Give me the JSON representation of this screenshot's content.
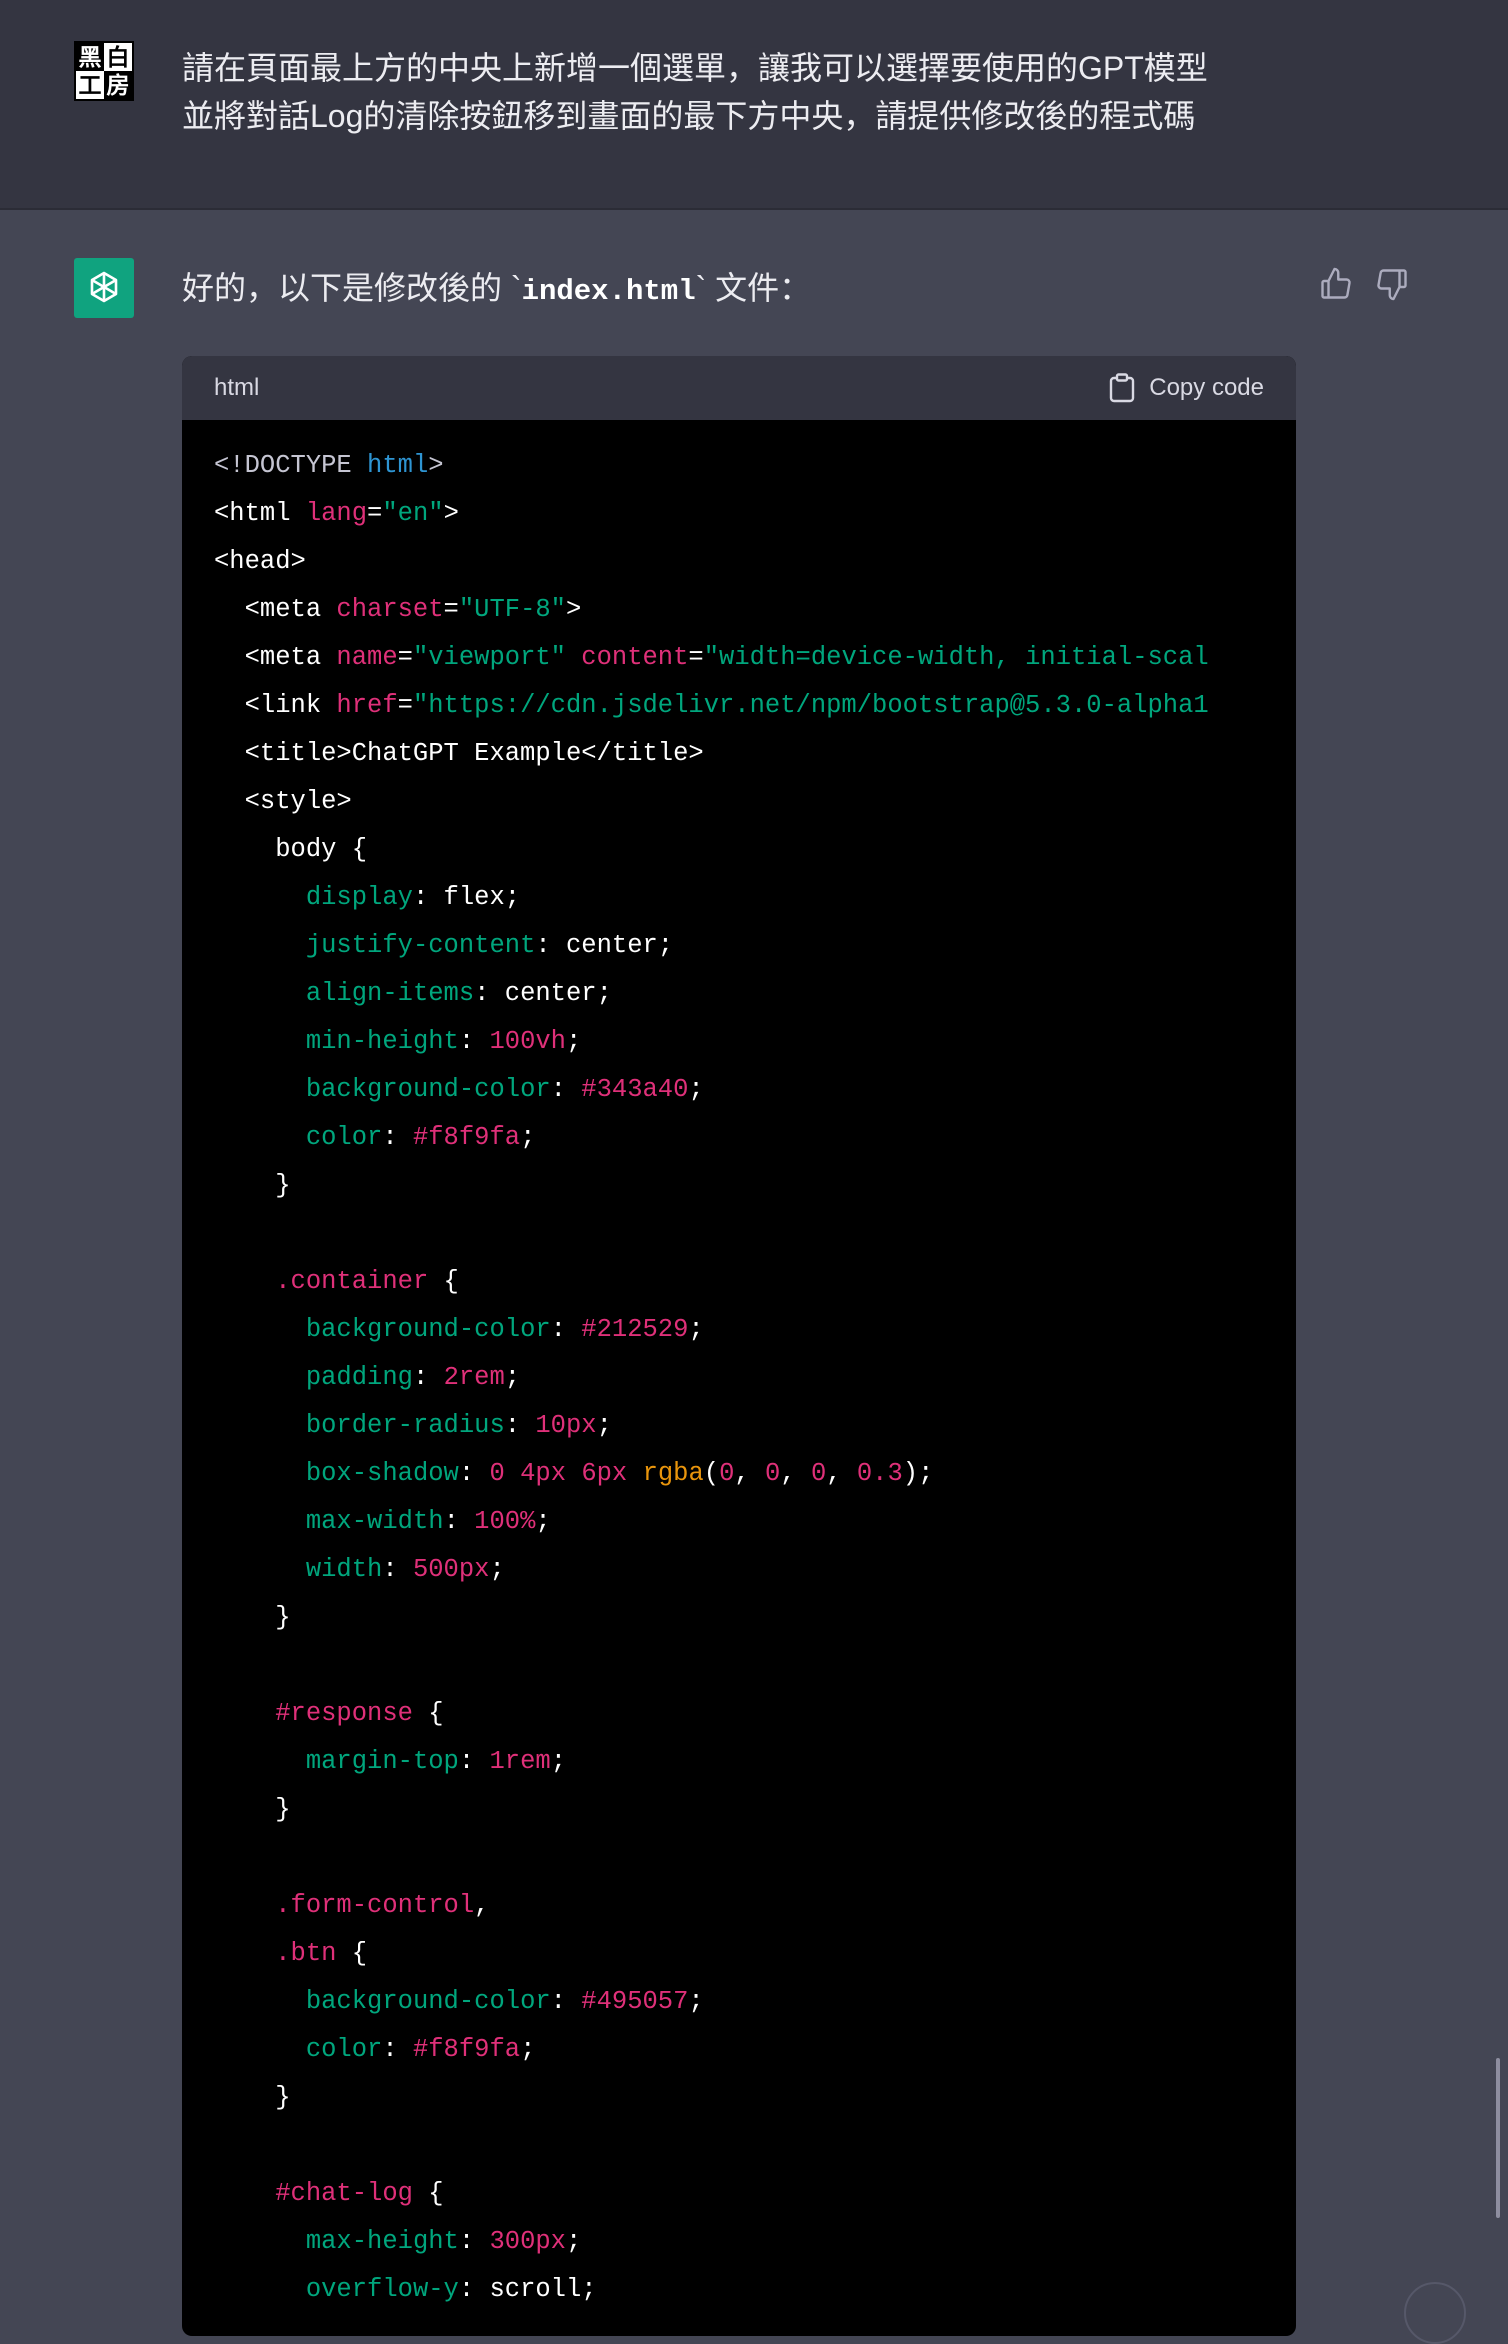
{
  "user": {
    "avatar": {
      "chars": [
        "黑",
        "白",
        "工",
        "房"
      ],
      "icon": "user-avatar-logo"
    },
    "lines": [
      "請在頁面最上方的中央上新增一個選單，讓我可以選擇要使用的GPT模型",
      "並將對話Log的清除按鈕移到畫面的最下方中央，請提供修改後的程式碼"
    ]
  },
  "assistant": {
    "intro_prefix": "好的，以下是修改後的 `",
    "intro_code": "index.html",
    "intro_suffix": "` 文件：",
    "feedback": {
      "thumb_up_icon": "thumbs-up-icon",
      "thumb_down_icon": "thumbs-down-icon"
    }
  },
  "code_block": {
    "language": "html",
    "copy_label": "Copy code",
    "lines": [
      [
        [
          "d",
          "<!DOCTYPE "
        ],
        [
          "k",
          "html"
        ],
        [
          "d",
          ">"
        ]
      ],
      [
        [
          "c",
          "<html "
        ],
        [
          "a",
          "lang"
        ],
        [
          "c",
          "="
        ],
        [
          "s",
          "\"en\""
        ],
        [
          "c",
          ">"
        ]
      ],
      [
        [
          "c",
          "<head>"
        ]
      ],
      [
        [
          "c",
          "  <meta "
        ],
        [
          "a",
          "charset"
        ],
        [
          "c",
          "="
        ],
        [
          "s",
          "\"UTF-8\""
        ],
        [
          "c",
          ">"
        ]
      ],
      [
        [
          "c",
          "  <meta "
        ],
        [
          "a",
          "name"
        ],
        [
          "c",
          "="
        ],
        [
          "s",
          "\"viewport\""
        ],
        [
          "c",
          " "
        ],
        [
          "a",
          "content"
        ],
        [
          "c",
          "="
        ],
        [
          "s",
          "\"width=device-width, initial-scal"
        ]
      ],
      [
        [
          "c",
          "  <link "
        ],
        [
          "a",
          "href"
        ],
        [
          "c",
          "="
        ],
        [
          "s",
          "\"https://cdn.jsdelivr.net/npm/bootstrap@5.3.0-alpha1"
        ]
      ],
      [
        [
          "c",
          "  <title>ChatGPT Example</title>"
        ]
      ],
      [
        [
          "c",
          "  <style>"
        ]
      ],
      [
        [
          "c",
          "    body {"
        ]
      ],
      [
        [
          "c",
          "      "
        ],
        [
          "p",
          "display"
        ],
        [
          "c",
          ": flex;"
        ]
      ],
      [
        [
          "c",
          "      "
        ],
        [
          "p",
          "justify-content"
        ],
        [
          "c",
          ": center;"
        ]
      ],
      [
        [
          "c",
          "      "
        ],
        [
          "p",
          "align-items"
        ],
        [
          "c",
          ": center;"
        ]
      ],
      [
        [
          "c",
          "      "
        ],
        [
          "p",
          "min-height"
        ],
        [
          "c",
          ": "
        ],
        [
          "n",
          "100vh"
        ],
        [
          "c",
          ";"
        ]
      ],
      [
        [
          "c",
          "      "
        ],
        [
          "p",
          "background-color"
        ],
        [
          "c",
          ": "
        ],
        [
          "n",
          "#343a40"
        ],
        [
          "c",
          ";"
        ]
      ],
      [
        [
          "c",
          "      "
        ],
        [
          "p",
          "color"
        ],
        [
          "c",
          ": "
        ],
        [
          "n",
          "#f8f9fa"
        ],
        [
          "c",
          ";"
        ]
      ],
      [
        [
          "c",
          "    }"
        ]
      ],
      [
        [
          "c",
          ""
        ]
      ],
      [
        [
          "c",
          "    "
        ],
        [
          "n",
          ".container"
        ],
        [
          "c",
          " {"
        ]
      ],
      [
        [
          "c",
          "      "
        ],
        [
          "p",
          "background-color"
        ],
        [
          "c",
          ": "
        ],
        [
          "n",
          "#212529"
        ],
        [
          "c",
          ";"
        ]
      ],
      [
        [
          "c",
          "      "
        ],
        [
          "p",
          "padding"
        ],
        [
          "c",
          ": "
        ],
        [
          "n",
          "2rem"
        ],
        [
          "c",
          ";"
        ]
      ],
      [
        [
          "c",
          "      "
        ],
        [
          "p",
          "border-radius"
        ],
        [
          "c",
          ": "
        ],
        [
          "n",
          "10px"
        ],
        [
          "c",
          ";"
        ]
      ],
      [
        [
          "c",
          "      "
        ],
        [
          "p",
          "box-shadow"
        ],
        [
          "c",
          ": "
        ],
        [
          "n",
          "0"
        ],
        [
          "c",
          " "
        ],
        [
          "n",
          "4px"
        ],
        [
          "c",
          " "
        ],
        [
          "n",
          "6px"
        ],
        [
          "c",
          " "
        ],
        [
          "f",
          "rgba"
        ],
        [
          "c",
          "("
        ],
        [
          "n",
          "0"
        ],
        [
          "c",
          ", "
        ],
        [
          "n",
          "0"
        ],
        [
          "c",
          ", "
        ],
        [
          "n",
          "0"
        ],
        [
          "c",
          ", "
        ],
        [
          "n",
          "0.3"
        ],
        [
          "c",
          ");"
        ]
      ],
      [
        [
          "c",
          "      "
        ],
        [
          "p",
          "max-width"
        ],
        [
          "c",
          ": "
        ],
        [
          "n",
          "100%"
        ],
        [
          "c",
          ";"
        ]
      ],
      [
        [
          "c",
          "      "
        ],
        [
          "p",
          "width"
        ],
        [
          "c",
          ": "
        ],
        [
          "n",
          "500px"
        ],
        [
          "c",
          ";"
        ]
      ],
      [
        [
          "c",
          "    }"
        ]
      ],
      [
        [
          "c",
          ""
        ]
      ],
      [
        [
          "c",
          "    "
        ],
        [
          "n",
          "#response"
        ],
        [
          "c",
          " {"
        ]
      ],
      [
        [
          "c",
          "      "
        ],
        [
          "p",
          "margin-top"
        ],
        [
          "c",
          ": "
        ],
        [
          "n",
          "1rem"
        ],
        [
          "c",
          ";"
        ]
      ],
      [
        [
          "c",
          "    }"
        ]
      ],
      [
        [
          "c",
          ""
        ]
      ],
      [
        [
          "c",
          "    "
        ],
        [
          "n",
          ".form-control"
        ],
        [
          "c",
          ","
        ]
      ],
      [
        [
          "c",
          "    "
        ],
        [
          "n",
          ".btn"
        ],
        [
          "c",
          " {"
        ]
      ],
      [
        [
          "c",
          "      "
        ],
        [
          "p",
          "background-color"
        ],
        [
          "c",
          ": "
        ],
        [
          "n",
          "#495057"
        ],
        [
          "c",
          ";"
        ]
      ],
      [
        [
          "c",
          "      "
        ],
        [
          "p",
          "color"
        ],
        [
          "c",
          ": "
        ],
        [
          "n",
          "#f8f9fa"
        ],
        [
          "c",
          ";"
        ]
      ],
      [
        [
          "c",
          "    }"
        ]
      ],
      [
        [
          "c",
          ""
        ]
      ],
      [
        [
          "c",
          "    "
        ],
        [
          "n",
          "#chat-log"
        ],
        [
          "c",
          " {"
        ]
      ],
      [
        [
          "c",
          "      "
        ],
        [
          "p",
          "max-height"
        ],
        [
          "c",
          ": "
        ],
        [
          "n",
          "300px"
        ],
        [
          "c",
          ";"
        ]
      ],
      [
        [
          "c",
          "      "
        ],
        [
          "p",
          "overflow-y"
        ],
        [
          "c",
          ": scroll;"
        ]
      ]
    ]
  },
  "colors": {
    "user_bg": "#343541",
    "assistant_bg": "#444654",
    "code_bg": "#000000",
    "gpt_avatar": "#10a37f"
  }
}
